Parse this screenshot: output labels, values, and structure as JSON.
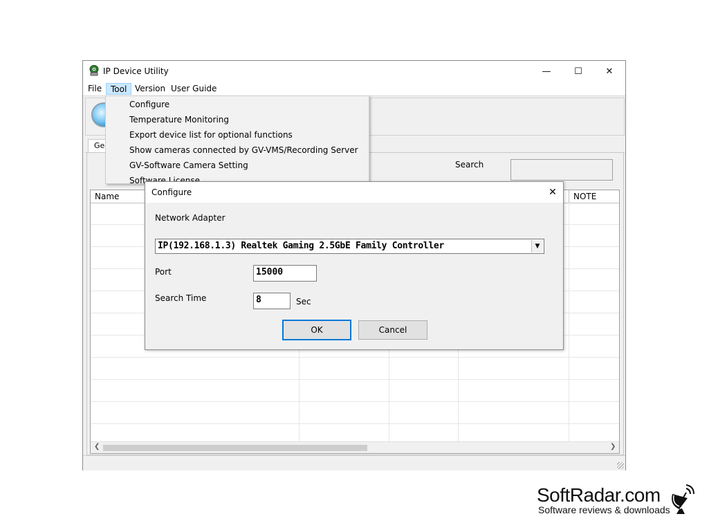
{
  "window": {
    "title": "IP Device Utility",
    "controls": {
      "minimize": "—",
      "maximize": "☐",
      "close": "✕"
    }
  },
  "menubar": {
    "items": [
      "File",
      "Tool",
      "Version",
      "User Guide"
    ],
    "active": "Tool"
  },
  "tool_menu": {
    "items": [
      "Configure",
      "Temperature Monitoring",
      "Export device list for optional functions",
      "Show cameras connected by GV-VMS/Recording Server",
      "GV-Software Camera Setting",
      "Software License"
    ]
  },
  "tabs": [
    "Gen"
  ],
  "search": {
    "label": "Search",
    "value": ""
  },
  "grid": {
    "columns": [
      "Name",
      "NOTE"
    ]
  },
  "configure_dialog": {
    "title": "Configure",
    "close": "✕",
    "network_adapter_label": "Network Adapter",
    "network_adapter_value": "IP(192.168.1.3) Realtek Gaming 2.5GbE Family Controller",
    "port_label": "Port",
    "port_value": "15000",
    "search_time_label": "Search Time",
    "search_time_value": "8",
    "search_time_unit": "Sec",
    "ok_label": "OK",
    "cancel_label": "Cancel"
  },
  "watermark": {
    "brand": "SoftRadar.com",
    "tagline": "Software reviews & downloads"
  },
  "colors": {
    "menu_highlight": "#cce8ff",
    "default_button_border": "#0078d7",
    "window_bg": "#f0f0f0"
  }
}
